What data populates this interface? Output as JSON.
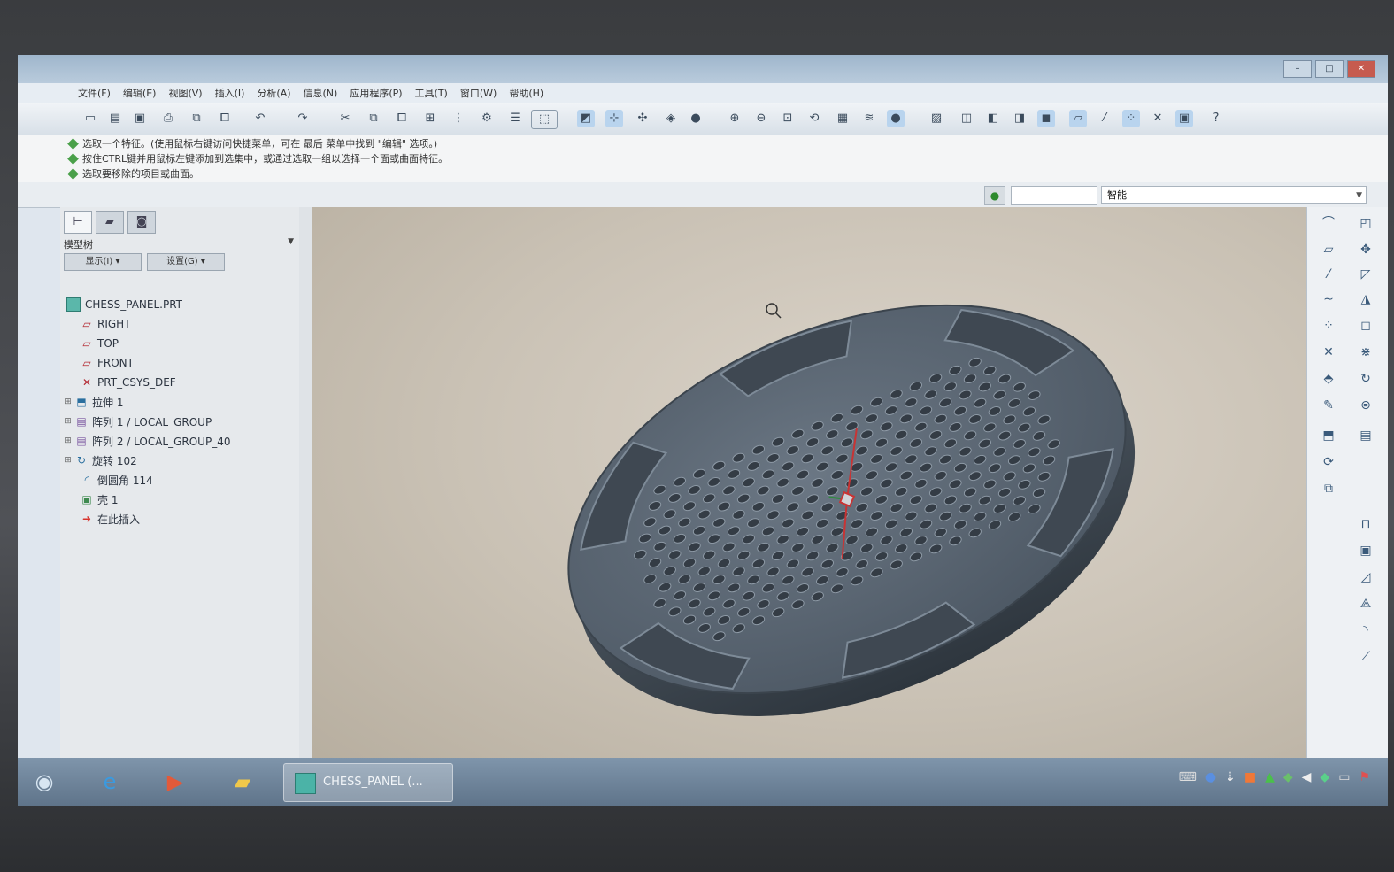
{
  "window": {
    "title": "",
    "controls": {
      "minimize": "–",
      "maximize": "□",
      "close": "✕"
    }
  },
  "menubar": {
    "items": [
      "文件(F)",
      "编辑(E)",
      "视图(V)",
      "插入(I)",
      "分析(A)",
      "信息(N)",
      "应用程序(P)",
      "工具(T)",
      "窗口(W)",
      "帮助(H)"
    ]
  },
  "toolbar": {
    "icons": [
      "new-icon",
      "open-icon",
      "save-icon",
      "print-icon",
      "copy-icon",
      "paste-icon",
      "undo-icon",
      "redo-icon",
      "cut-icon",
      "copy-icon",
      "paste-icon",
      "regenerate-icon",
      "select-icon",
      "zoom-in-icon",
      "zoom-out-icon",
      "refit-icon",
      "orient-icon",
      "view-manager-icon",
      "layer-icon",
      "appearance-icon",
      "datum-planes-icon",
      "datum-axes-icon",
      "datum-points-icon",
      "csys-icon",
      "help-icon"
    ]
  },
  "messages": [
    "选取一个特征。(使用鼠标右键访问快捷菜单，可在 最后 菜单中找到 \"编辑\" 选项。)",
    "按住CTRL键并用鼠标左键添加到选集中，或通过选取一组以选择一个面或曲面特征。",
    "选取要移除的项目或曲面。"
  ],
  "statusbar": {
    "traffic_light": "●",
    "filter_value": "智能"
  },
  "model_tree": {
    "title": "模型树",
    "buttons": [
      "显示(I) ▾",
      "设置(G) ▾"
    ],
    "nodes": [
      {
        "label": "CHESS_PANEL.PRT",
        "icon": "part-icon",
        "level": 0
      },
      {
        "label": "RIGHT",
        "icon": "datum-plane-icon",
        "level": 1
      },
      {
        "label": "TOP",
        "icon": "datum-plane-icon",
        "level": 1
      },
      {
        "label": "FRONT",
        "icon": "datum-plane-icon",
        "level": 1
      },
      {
        "label": "PRT_CSYS_DEF",
        "icon": "csys-icon",
        "level": 1
      },
      {
        "label": "拉伸 1",
        "icon": "extrude-icon",
        "level": 1,
        "expandable": true
      },
      {
        "label": "阵列 1 / LOCAL_GROUP",
        "icon": "pattern-icon",
        "level": 1,
        "expandable": true
      },
      {
        "label": "阵列 2 / LOCAL_GROUP_40",
        "icon": "pattern-icon",
        "level": 1,
        "expandable": true
      },
      {
        "label": "旋转 102",
        "icon": "revolve-icon",
        "level": 1,
        "expandable": true
      },
      {
        "label": "倒圆角 114",
        "icon": "round-icon",
        "level": 1
      },
      {
        "label": "壳 1",
        "icon": "shell-icon",
        "level": 1
      },
      {
        "label": "在此插入",
        "icon": "insert-here-icon",
        "level": 1
      }
    ]
  },
  "taskbar": {
    "items": [
      "start-icon",
      "ie-icon",
      "media-player-icon",
      "explorer-icon"
    ],
    "active_window": "CHESS_PANEL (..."
  }
}
